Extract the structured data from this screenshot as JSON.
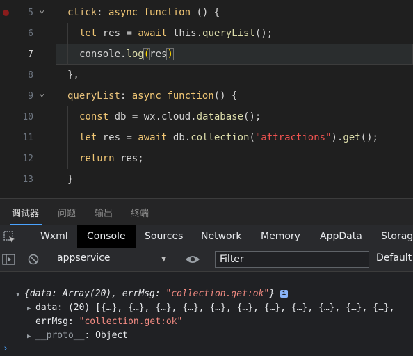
{
  "editor": {
    "lines": [
      {
        "num": "5"
      },
      {
        "num": "6"
      },
      {
        "num": "7"
      },
      {
        "num": "8"
      },
      {
        "num": "9"
      },
      {
        "num": "10"
      },
      {
        "num": "11"
      },
      {
        "num": "12"
      },
      {
        "num": "13"
      }
    ],
    "code": {
      "l5_key": "click",
      "l5_colon": ": ",
      "l5_async": "async",
      "l5_function": " function",
      "l5_rest": " () {",
      "l6_let": "let",
      "l6_mid": " res = ",
      "l6_await": "await",
      "l6_this": " this.",
      "l6_fn": "queryList",
      "l6_end": "();",
      "l7_obj": "console.",
      "l7_fn": "log",
      "l7_open": "(",
      "l7_arg": "res",
      "l7_close": ")",
      "l8": "},",
      "l9_key": "queryList",
      "l9_colon": ": ",
      "l9_async": "async",
      "l9_function": " function",
      "l9_rest": "() {",
      "l10_const": "const",
      "l10_mid": " db = wx.cloud.",
      "l10_fn": "database",
      "l10_end": "();",
      "l11_let": "let",
      "l11_mid": " res = ",
      "l11_await": "await",
      "l11_db": " db.",
      "l11_fn": "collection",
      "l11_open": "(",
      "l11_str": "\"attractions\"",
      "l11_close": ").",
      "l11_get": "get",
      "l11_end": "();",
      "l12_return": "return",
      "l12_rest": " res;",
      "l13": "}"
    },
    "current_line": "7"
  },
  "devtools_tabs": [
    "调试器",
    "问题",
    "输出",
    "终端"
  ],
  "panel_tabs": [
    "Wxml",
    "Console",
    "Sources",
    "Network",
    "Memory",
    "AppData",
    "Storage"
  ],
  "active_panel": "Console",
  "toolbar": {
    "context": "appservice",
    "filter_placeholder": "Filter",
    "levels": "Default"
  },
  "console": {
    "summary_open": "{",
    "summary_key1": "data",
    "summary_val1": ": Array(20), ",
    "summary_key2": "errMsg",
    "summary_colon2": ": ",
    "summary_str": "\"collection.get:ok\"",
    "summary_close": "}",
    "data_key": "data",
    "data_val": ": (20) [{…}, {…}, {…}, {…}, {…}, {…}, {…}, {…}, {…}, {…}, {…},",
    "errmsg_key": "errMsg",
    "errmsg_colon": ": ",
    "errmsg_val": "\"collection.get:ok\"",
    "proto_key": "__proto__",
    "proto_val": ": Object",
    "prompt": "›"
  }
}
